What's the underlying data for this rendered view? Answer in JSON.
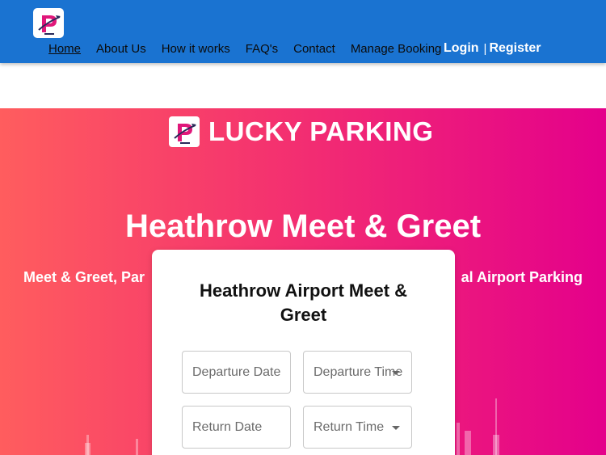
{
  "nav": {
    "logo_icon": "lucky-parking-logo-icon",
    "links": [
      {
        "label": "Home",
        "active": true
      },
      {
        "label": "About Us",
        "active": false
      },
      {
        "label": "How it works",
        "active": false
      },
      {
        "label": "FAQ's",
        "active": false
      },
      {
        "label": "Contact",
        "active": false
      },
      {
        "label": "Manage Booking",
        "active": false
      }
    ],
    "login_label": "Login",
    "separator": "|",
    "register_label": "Register",
    "bg_color": "#1a73d1"
  },
  "hero": {
    "brand_name": "LUCKY PARKING",
    "title": "Heathrow Meet & Greet",
    "subtitle_left": "Meet & Greet, Par",
    "subtitle_right": "al Airport Parking",
    "gradient_colors": [
      "#ff5d5e",
      "#f4326f",
      "#e4008b"
    ]
  },
  "booking_card": {
    "title_line1": "Heathrow Airport Meet &",
    "title_line2": "Greet",
    "departure_date_placeholder": "Departure Date",
    "departure_time_placeholder": "Departure Time",
    "return_date_placeholder": "Return Date",
    "return_time_placeholder": "Return Time"
  }
}
